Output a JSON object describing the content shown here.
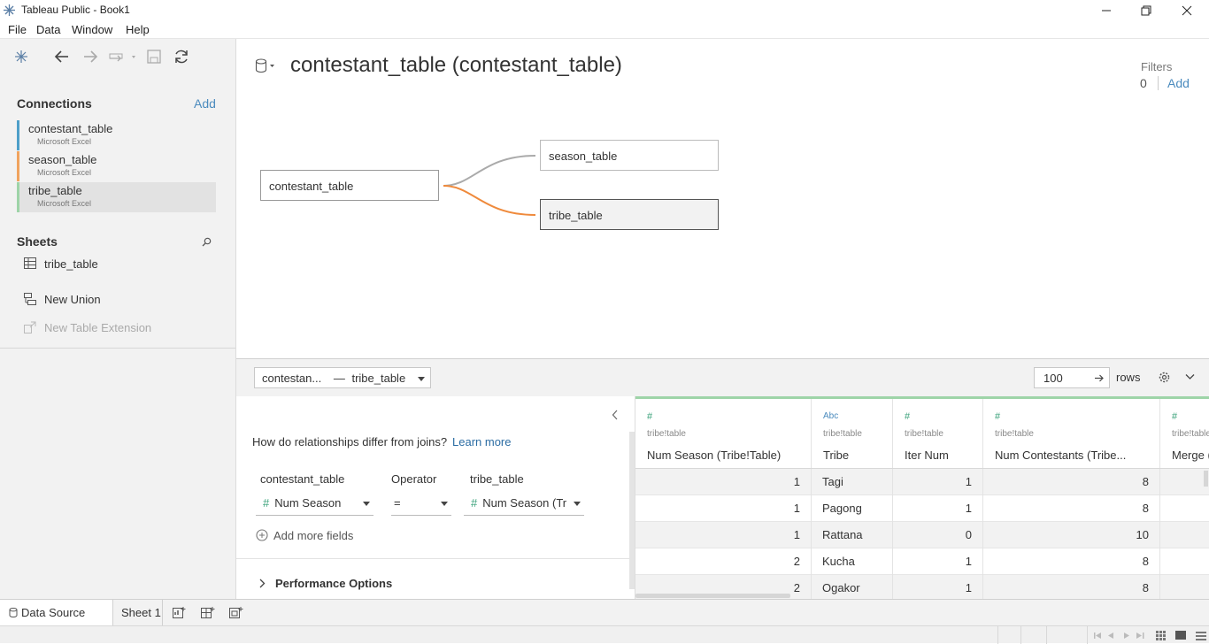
{
  "window": {
    "title": "Tableau Public - Book1"
  },
  "menu": [
    "File",
    "Data",
    "Window",
    "Help"
  ],
  "left_panel": {
    "connections_title": "Connections",
    "add_label": "Add",
    "connections": [
      {
        "name": "contestant_table",
        "type": "Microsoft Excel",
        "color": "#4e9fc9"
      },
      {
        "name": "season_table",
        "type": "Microsoft Excel",
        "color": "#f0a35e"
      },
      {
        "name": "tribe_table",
        "type": "Microsoft Excel",
        "color": "#9ed4a8"
      }
    ],
    "sheets_title": "Sheets",
    "sheets": [
      "tribe_table"
    ],
    "new_union": "New Union",
    "new_table_extension": "New Table Extension"
  },
  "canvas": {
    "title": "contestant_table (contestant_table)",
    "filters_label": "Filters",
    "filters_count": "0",
    "filters_add": "Add",
    "nodes": {
      "root": "contestant_table",
      "child1": "season_table",
      "child2": "tribe_table"
    }
  },
  "grid_bar": {
    "relation_left": "contestan...",
    "relation_sep": "—",
    "relation_right": "tribe_table",
    "rows_value": "100",
    "rows_label": "rows"
  },
  "relationship": {
    "question": "How do relationships differ from joins?",
    "learn_more": "Learn more",
    "left_header": "contestant_table",
    "operator_header": "Operator",
    "right_header": "tribe_table",
    "left_field": "Num Season",
    "operator": "=",
    "right_field": "Num Season (Tr",
    "add_more": "Add more fields",
    "performance": "Performance Options"
  },
  "data_grid": {
    "columns": [
      {
        "type": "#",
        "source": "tribe!table",
        "name": "Num Season (Tribe!Table)"
      },
      {
        "type": "Abc",
        "source": "tribe!table",
        "name": "Tribe"
      },
      {
        "type": "#",
        "source": "tribe!table",
        "name": "Iter Num"
      },
      {
        "type": "#",
        "source": "tribe!table",
        "name": "Num Contestants (Tribe..."
      },
      {
        "type": "#",
        "source": "tribe!table",
        "name": "Merge ("
      }
    ],
    "rows": [
      [
        "1",
        "Tagi",
        "1",
        "8"
      ],
      [
        "1",
        "Pagong",
        "1",
        "8"
      ],
      [
        "1",
        "Rattana",
        "0",
        "10"
      ],
      [
        "2",
        "Kucha",
        "1",
        "8"
      ],
      [
        "2",
        "Ogakor",
        "1",
        "8"
      ]
    ]
  },
  "tabs": {
    "data_source": "Data Source",
    "sheet1": "Sheet 1"
  }
}
